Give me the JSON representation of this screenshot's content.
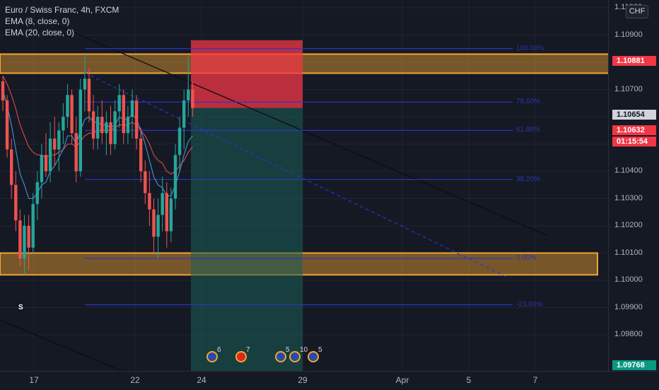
{
  "legend": {
    "symbol": "Euro / Swiss Franc, 4h, FXCM",
    "ema8": "EMA (8, close, 0)",
    "ema20": "EMA (20, close, 0)"
  },
  "price_axis": {
    "currency": "CHF",
    "ticks": [
      "1.11100",
      "1.11000",
      "1.10900",
      "1.10800",
      "1.10700",
      "1.10600",
      "1.10500",
      "1.10400",
      "1.10300",
      "1.10200",
      "1.10100",
      "1.10000",
      "1.09900",
      "1.09800"
    ],
    "tags": [
      {
        "value": "1.10881",
        "bg": "#f23645",
        "color": "#ffffff"
      },
      {
        "value": "1.10654",
        "bg": "#d1d4dc",
        "color": "#131722"
      },
      {
        "value": "1.10632",
        "bg": "#f23645",
        "color": "#ffffff"
      },
      {
        "value": "01:15:54",
        "bg": "#f23645",
        "color": "#ffffff"
      },
      {
        "value": "1.09768",
        "bg": "#089981",
        "color": "#ffffff"
      }
    ]
  },
  "time_axis": {
    "ticks": [
      "17",
      "22",
      "24",
      "29",
      "Apr",
      "5",
      "7"
    ]
  },
  "fib_labels": [
    "100.00%",
    "78.60%",
    "61.80%",
    "38.20%",
    "0.00%",
    "-23.60%"
  ],
  "events": [
    {
      "flag": "eu",
      "count": "6"
    },
    {
      "flag": "ch",
      "count": "7"
    },
    {
      "flag": "eu",
      "count": "5"
    },
    {
      "flag": "eu",
      "count": "10"
    },
    {
      "flag": "eu",
      "count": "5"
    }
  ],
  "signal": "S",
  "colors": {
    "bull": "#26a69a",
    "bear": "#ef5350",
    "zone": "#f0a433",
    "fib": "#2a35c8",
    "stop": "#f23645",
    "target": "#1b5e55"
  },
  "chart_data": {
    "type": "candlestick",
    "symbol": "EURCHF",
    "timeframe": "4h",
    "ylim": [
      1.0976,
      1.1113
    ],
    "resistance_zone": [
      1.1076,
      1.1083
    ],
    "support_zone": [
      1.1002,
      1.101
    ],
    "short_position": {
      "entry": 1.10632,
      "stop": 1.10881,
      "target": 1.10005
    },
    "fib_levels": [
      {
        "label": "100.00%",
        "price": 1.1085
      },
      {
        "label": "78.60%",
        "price": 1.10654
      },
      {
        "label": "61.80%",
        "price": 1.1055
      },
      {
        "label": "38.20%",
        "price": 1.1037
      },
      {
        "label": "0.00%",
        "price": 1.1008
      },
      {
        "label": "-23.60%",
        "price": 1.0991
      }
    ],
    "candles": [
      [
        1.1073,
        1.1075,
        1.1062,
        1.1066
      ],
      [
        1.1066,
        1.1068,
        1.1045,
        1.1048
      ],
      [
        1.1048,
        1.1052,
        1.103,
        1.1035
      ],
      [
        1.1035,
        1.104,
        1.1018,
        1.1022
      ],
      [
        1.1022,
        1.1026,
        1.1005,
        1.1008
      ],
      [
        1.1008,
        1.1024,
        1.1002,
        1.102
      ],
      [
        1.102,
        1.1024,
        1.1004,
        1.1012
      ],
      [
        1.1012,
        1.1032,
        1.101,
        1.1028
      ],
      [
        1.1028,
        1.104,
        1.1022,
        1.1036
      ],
      [
        1.1036,
        1.105,
        1.103,
        1.1046
      ],
      [
        1.1046,
        1.1054,
        1.1038,
        1.104
      ],
      [
        1.104,
        1.1058,
        1.1036,
        1.1052
      ],
      [
        1.1052,
        1.106,
        1.1042,
        1.1048
      ],
      [
        1.1048,
        1.1058,
        1.104,
        1.1055
      ],
      [
        1.1055,
        1.1065,
        1.105,
        1.106
      ],
      [
        1.106,
        1.1072,
        1.1056,
        1.1068
      ],
      [
        1.1068,
        1.107,
        1.105,
        1.1054
      ],
      [
        1.1054,
        1.106,
        1.1036,
        1.104
      ],
      [
        1.104,
        1.1074,
        1.1038,
        1.107
      ],
      [
        1.107,
        1.1082,
        1.1062,
        1.1074
      ],
      [
        1.1074,
        1.1078,
        1.1058,
        1.1062
      ],
      [
        1.1062,
        1.1068,
        1.1048,
        1.1052
      ],
      [
        1.1052,
        1.1064,
        1.1048,
        1.106
      ],
      [
        1.106,
        1.1066,
        1.105,
        1.1054
      ],
      [
        1.1054,
        1.1062,
        1.1046,
        1.1058
      ],
      [
        1.1058,
        1.1064,
        1.1046,
        1.105
      ],
      [
        1.105,
        1.1066,
        1.1048,
        1.1062
      ],
      [
        1.1062,
        1.1072,
        1.1056,
        1.1068
      ],
      [
        1.1068,
        1.107,
        1.105,
        1.1054
      ],
      [
        1.1054,
        1.1064,
        1.105,
        1.106
      ],
      [
        1.106,
        1.107,
        1.1052,
        1.1066
      ],
      [
        1.1066,
        1.1068,
        1.1048,
        1.1052
      ],
      [
        1.1052,
        1.1056,
        1.1036,
        1.104
      ],
      [
        1.104,
        1.1044,
        1.1028,
        1.1032
      ],
      [
        1.1032,
        1.104,
        1.102,
        1.1026
      ],
      [
        1.1026,
        1.103,
        1.101,
        1.1016
      ],
      [
        1.1016,
        1.103,
        1.1008,
        1.1024
      ],
      [
        1.1024,
        1.1038,
        1.1018,
        1.1032
      ],
      [
        1.1032,
        1.1036,
        1.1012,
        1.1018
      ],
      [
        1.1018,
        1.1034,
        1.1014,
        1.103
      ],
      [
        1.103,
        1.105,
        1.1026,
        1.1046
      ],
      [
        1.1046,
        1.106,
        1.104,
        1.1056
      ],
      [
        1.1056,
        1.107,
        1.1048,
        1.1066
      ],
      [
        1.1066,
        1.1082,
        1.106,
        1.107
      ],
      [
        1.107,
        1.1073,
        1.106,
        1.10632
      ]
    ],
    "ema8": [
      1.107,
      1.1064,
      1.1057,
      1.1048,
      1.1039,
      1.1035,
      1.103,
      1.103,
      1.1032,
      1.1035,
      1.1036,
      1.104,
      1.1042,
      1.1045,
      1.1048,
      1.1053,
      1.1053,
      1.105,
      1.1055,
      1.1059,
      1.106,
      1.1058,
      1.1058,
      1.1057,
      1.1057,
      1.1056,
      1.1057,
      1.106,
      1.1059,
      1.1059,
      1.1061,
      1.1059,
      1.1055,
      1.105,
      1.1044,
      1.1038,
      1.1035,
      1.1034,
      1.1031,
      1.1031,
      1.1035,
      1.104,
      1.1046,
      1.1051,
      1.1053
    ],
    "ema20": [
      1.1075,
      1.1072,
      1.1068,
      1.1063,
      1.1057,
      1.1053,
      1.1049,
      1.1047,
      1.1046,
      1.1046,
      1.1045,
      1.1046,
      1.1046,
      1.1047,
      1.1048,
      1.105,
      1.105,
      1.1049,
      1.1051,
      1.1053,
      1.1054,
      1.1054,
      1.1055,
      1.1055,
      1.1055,
      1.1055,
      1.1056,
      1.1057,
      1.1057,
      1.1057,
      1.1058,
      1.1057,
      1.1055,
      1.1053,
      1.105,
      1.1046,
      1.1044,
      1.1043,
      1.104,
      1.1039,
      1.104,
      1.1042,
      1.1044,
      1.1047,
      1.1049
    ]
  }
}
